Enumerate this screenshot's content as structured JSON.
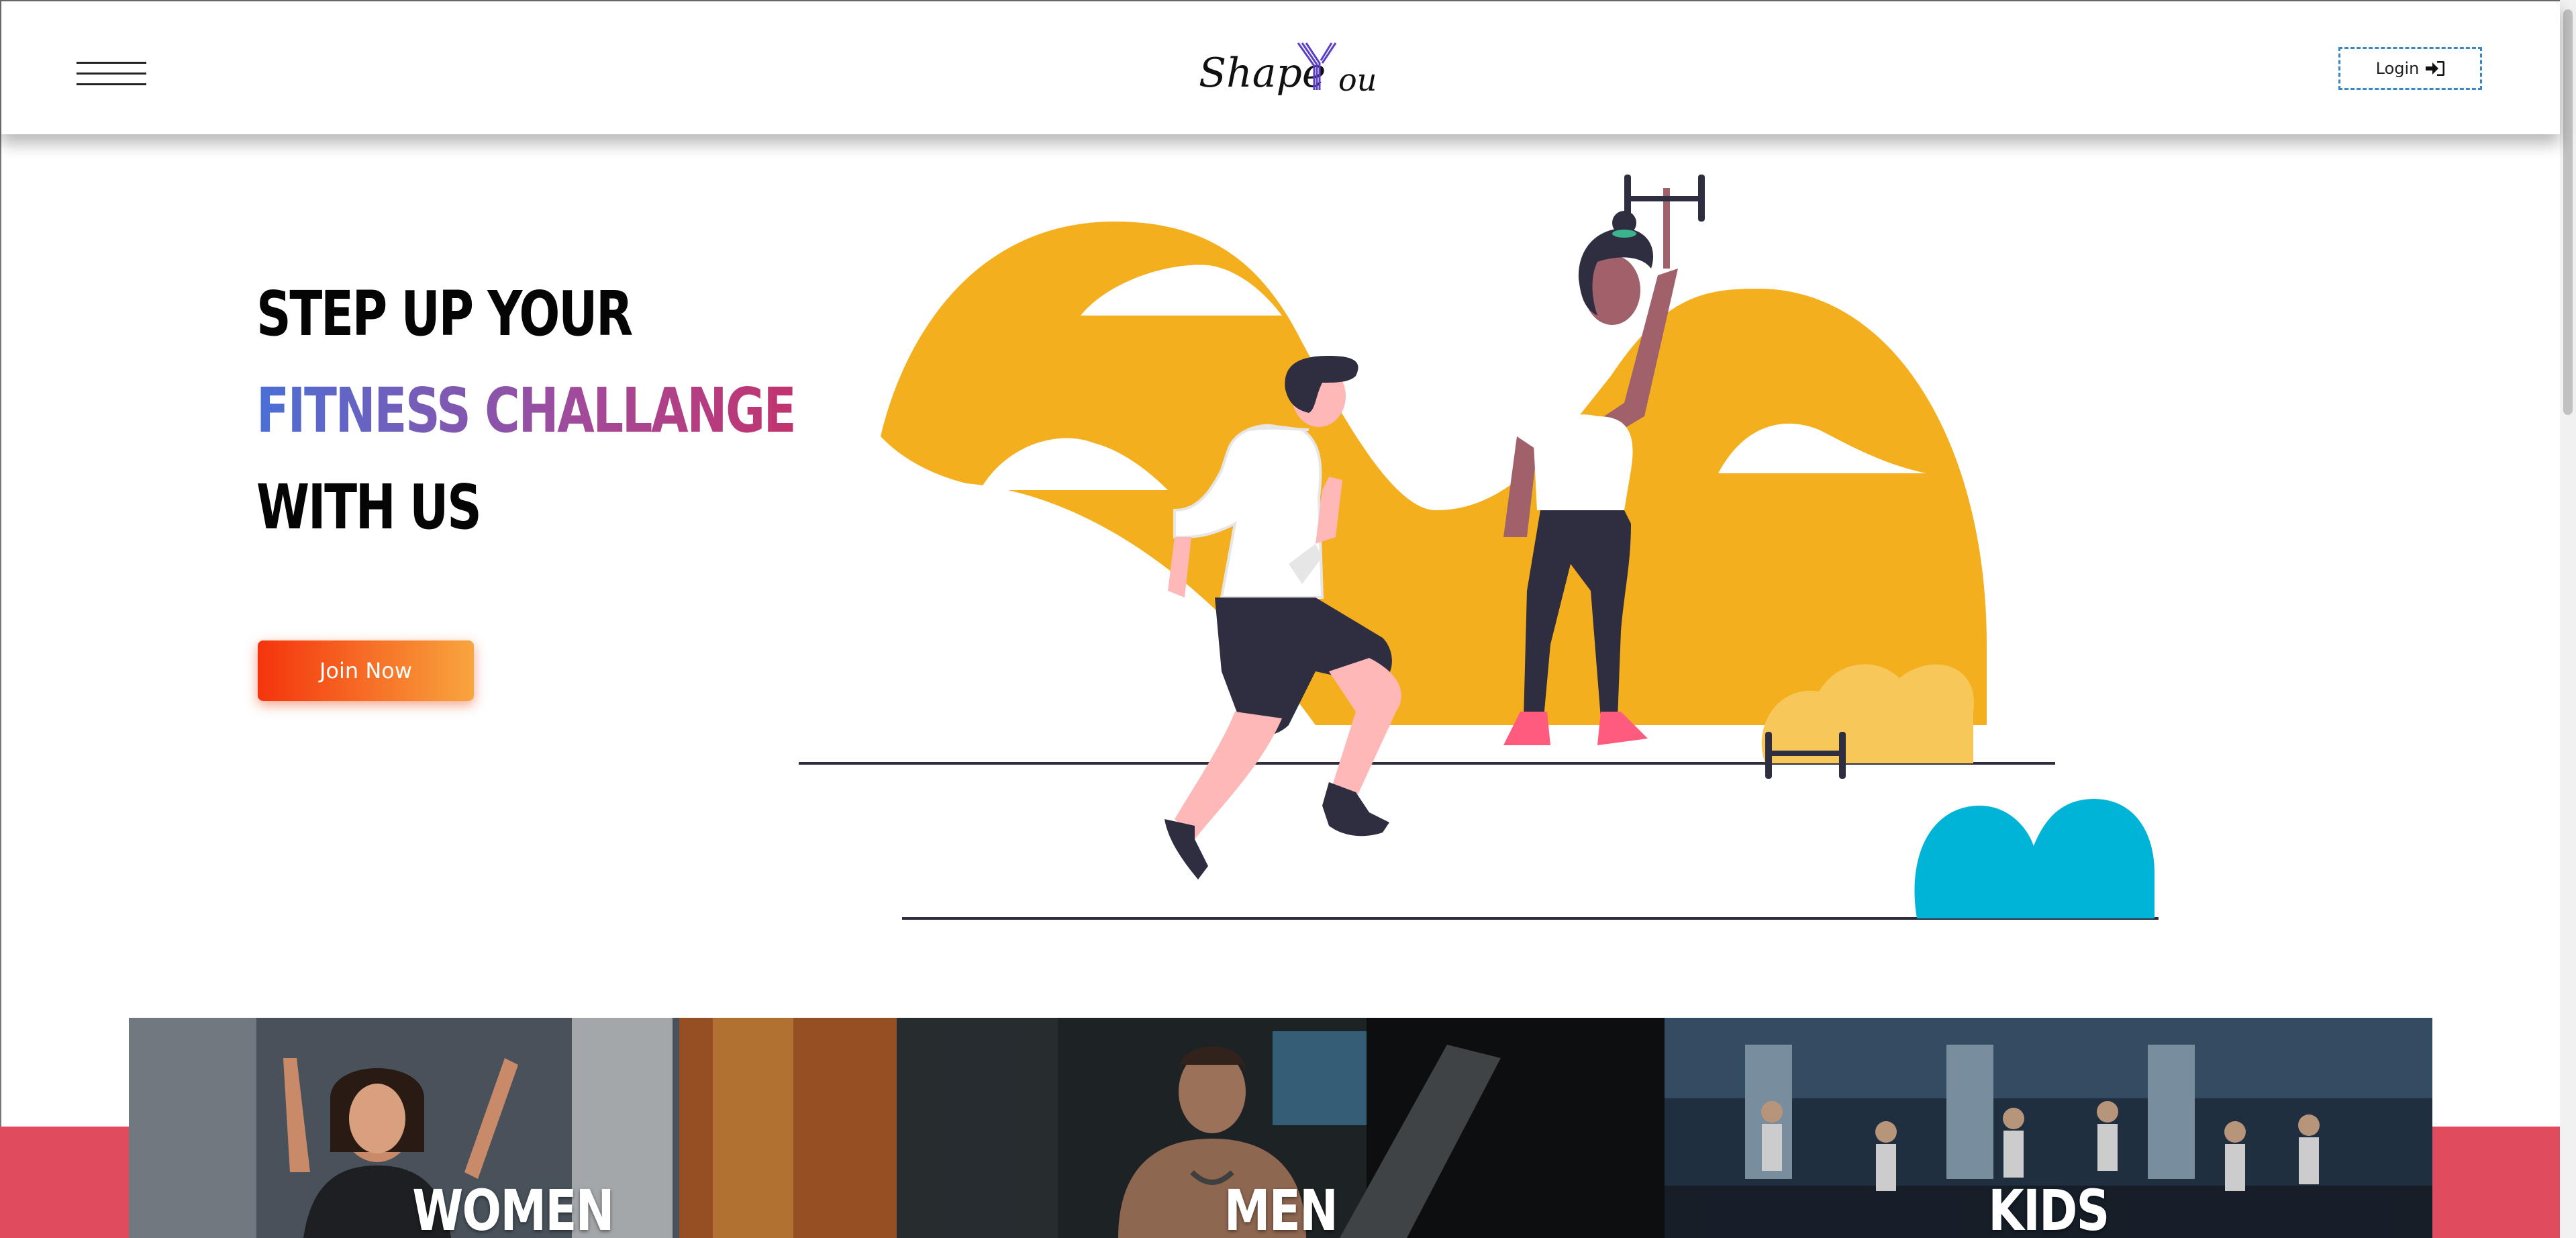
{
  "header": {
    "menu_icon": "hamburger-menu-icon",
    "logo": {
      "part1": "Shape",
      "letter": "Y",
      "part2": "ou"
    },
    "login_label": "Login",
    "login_icon": "sign-in-icon"
  },
  "hero": {
    "line1": "STEP UP YOUR",
    "line2": "FITNESS CHALLANGE",
    "line3": "WITH US",
    "cta_label": "Join Now",
    "illustration": "fitness-illustration"
  },
  "categories": [
    {
      "label": "WOMEN"
    },
    {
      "label": "MEN"
    },
    {
      "label": "KIDS"
    }
  ],
  "colors": {
    "accent_orange": "#f4340d",
    "accent_yellow": "#f4af1f",
    "band_pink": "#e04b5e",
    "bush_blue": "#00b4d8",
    "login_border": "#3d86c6"
  }
}
